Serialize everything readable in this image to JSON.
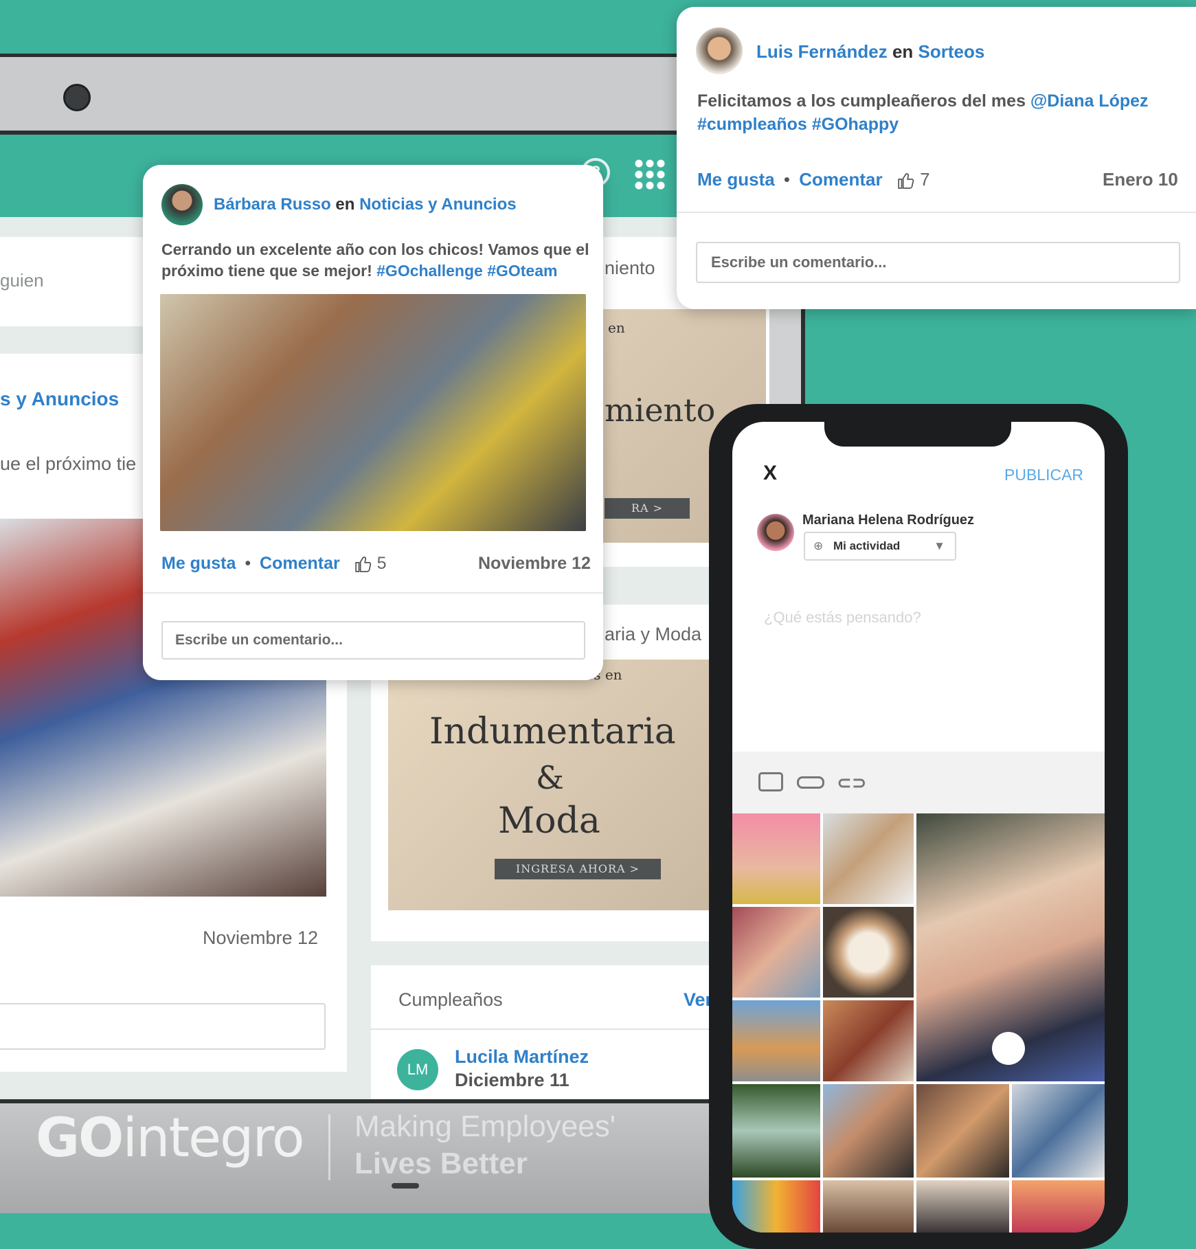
{
  "colors": {
    "teal": "#3db39c",
    "link": "#2f80c9",
    "gray": "#666666"
  },
  "card_luis": {
    "author": "Luis Fernández",
    "conn": "en",
    "group": "Sorteos",
    "text": "Felicitamos a los cumpleañeros del mes",
    "mention": "@Diana López",
    "tags": "#cumpleaños #GOhappy",
    "like": "Me gusta",
    "comment": "Comentar",
    "likes": "7",
    "date": "Enero 10",
    "placeholder": "Escribe un comentario..."
  },
  "card_barbara": {
    "author": "Bárbara Russo",
    "conn": "en",
    "group": "Noticias y Anuncios",
    "text": "Cerrando un excelente año con los chicos! Vamos que el próximo tiene que se mejor!",
    "tags": "#GOchallenge #GOteam",
    "like": "Me gusta",
    "comment": "Comentar",
    "likes": "5",
    "date": "Noviembre 12",
    "placeholder": "Escribe un comentario..."
  },
  "background": {
    "search_fragment": "guien",
    "group_fragment": "s y Anuncios",
    "text_fragment": "ue el próximo tie",
    "date": "Noviembre 12",
    "right_fragment_1": "niento",
    "promo1_fragment": "miento",
    "promo1_small": "en",
    "promo1_btn": "RA >",
    "right_fragment_2": "aria y Moda",
    "promo2_small": "Beneficios en",
    "promo2_line1": "Indumentaria",
    "promo2_amp": "&",
    "promo2_line2": "Moda",
    "promo2_btn": "INGRESA AHORA >",
    "birthdays_title": "Cumpleaños",
    "birthdays_more": "Ver",
    "bday_initials": "LM",
    "bday_name": "Lucila Martínez",
    "bday_date": "Diciembre 11"
  },
  "phone": {
    "close": "X",
    "publish": "PUBLICAR",
    "user": "Mariana Helena Rodríguez",
    "audience": "Mi actividad",
    "placeholder": "¿Qué estás pensando?"
  },
  "brand": {
    "go": "GO",
    "integro": "integro",
    "tagline1": "Making Employees'",
    "tagline2": "Lives Better"
  }
}
